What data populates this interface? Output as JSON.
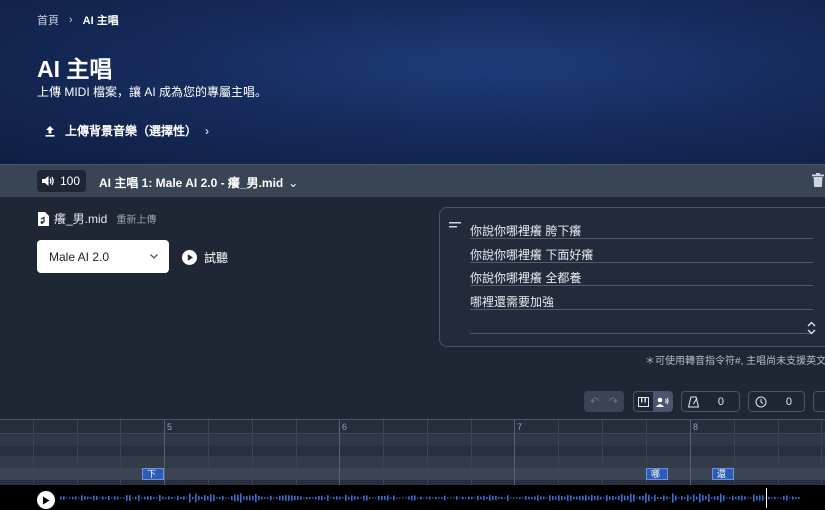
{
  "breadcrumb": {
    "home": "首頁",
    "current": "AI 主唱"
  },
  "hero": {
    "title": "AI 主唱",
    "subtitle": "上傳 MIDI 檔案，讓 AI 成為您的專屬主唱。",
    "upload_bg_label": "上傳背景音樂（選擇性）"
  },
  "track": {
    "volume": "100",
    "title": "AI 主唱 1: Male AI 2.0 - 癢_男.mid"
  },
  "file": {
    "name": "癢_男.mid",
    "reupload": "重新上傳"
  },
  "voice": {
    "selected": "Male AI 2.0"
  },
  "preview_label": "試聽",
  "lyrics": [
    "你說你哪裡癢 胯下癢",
    "你說你哪裡癢 下面好癢",
    "你說你哪裡癢 全都養",
    "哪裡還需要加強",
    ""
  ],
  "hint": "＊可使用轉音指令符#, 主唱尚未支援英文",
  "toolbar": {
    "bpm_value": "0",
    "timer_value": "0"
  },
  "roll": {
    "bars": [
      "5",
      "6",
      "7",
      "8"
    ],
    "notes": [
      {
        "label": "下"
      },
      {
        "label": "哪"
      },
      {
        "label": "還"
      }
    ]
  },
  "colors": {
    "accent": "#2e5bb3",
    "hero": "#142a5c",
    "panel": "#1f2735"
  }
}
